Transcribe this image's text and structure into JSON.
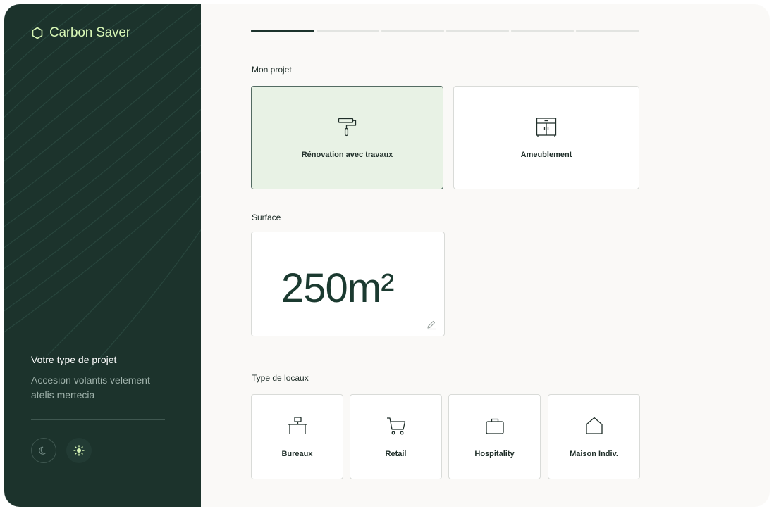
{
  "brand": {
    "name": "Carbon Saver"
  },
  "sidebar": {
    "title": "Votre type de projet",
    "description": "Accesion volantis velement atelis mertecia"
  },
  "theme_toggle": {
    "dark_icon": "moon-icon",
    "light_icon": "sun-icon",
    "active": "light"
  },
  "progress": {
    "steps_total": 6,
    "current_step": 1
  },
  "project": {
    "label": "Mon projet",
    "options": [
      {
        "label": "Rénovation avec travaux",
        "icon": "paint-roller-icon",
        "selected": true
      },
      {
        "label": "Ameublement",
        "icon": "cabinet-icon",
        "selected": false
      }
    ]
  },
  "surface": {
    "label": "Surface",
    "value": "250m²"
  },
  "locaux": {
    "label": "Type de locaux",
    "options": [
      {
        "label": "Bureaux",
        "icon": "desk-icon"
      },
      {
        "label": "Retail",
        "icon": "cart-icon"
      },
      {
        "label": "Hospitality",
        "icon": "briefcase-icon"
      },
      {
        "label": "Maison Indiv.",
        "icon": "house-icon"
      }
    ]
  },
  "colors": {
    "sidebar": "#1c332c",
    "accent": "#d6f5b5",
    "selected_card": "#e8f2e5",
    "progress_active": "#1c332c"
  }
}
